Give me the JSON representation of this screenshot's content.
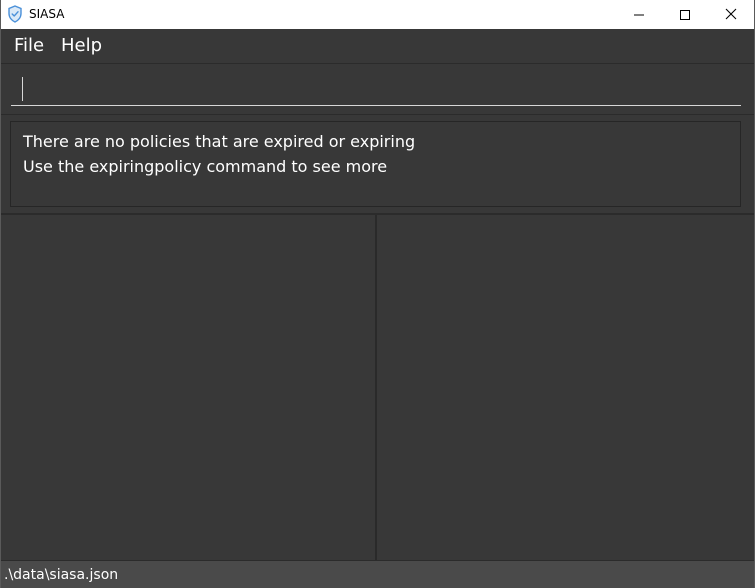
{
  "window": {
    "title": "SIASA",
    "icon": "shield-icon",
    "controls": {
      "minimize_icon": "minimize-icon",
      "maximize_icon": "maximize-icon",
      "close_icon": "close-icon"
    }
  },
  "menu": {
    "items": [
      {
        "label": "File"
      },
      {
        "label": "Help"
      }
    ]
  },
  "command": {
    "value": "",
    "placeholder": ""
  },
  "result": {
    "lines": [
      "There are no policies that are expired or expiring",
      "Use the expiringpolicy command to see more"
    ]
  },
  "status": {
    "file_path": ".\\data\\siasa.json"
  },
  "colors": {
    "background": "#383838",
    "titlebar": "#ffffff",
    "statusbar": "#4a4a4a",
    "text": "#ffffff",
    "icon_accent": "#4a90d9"
  }
}
